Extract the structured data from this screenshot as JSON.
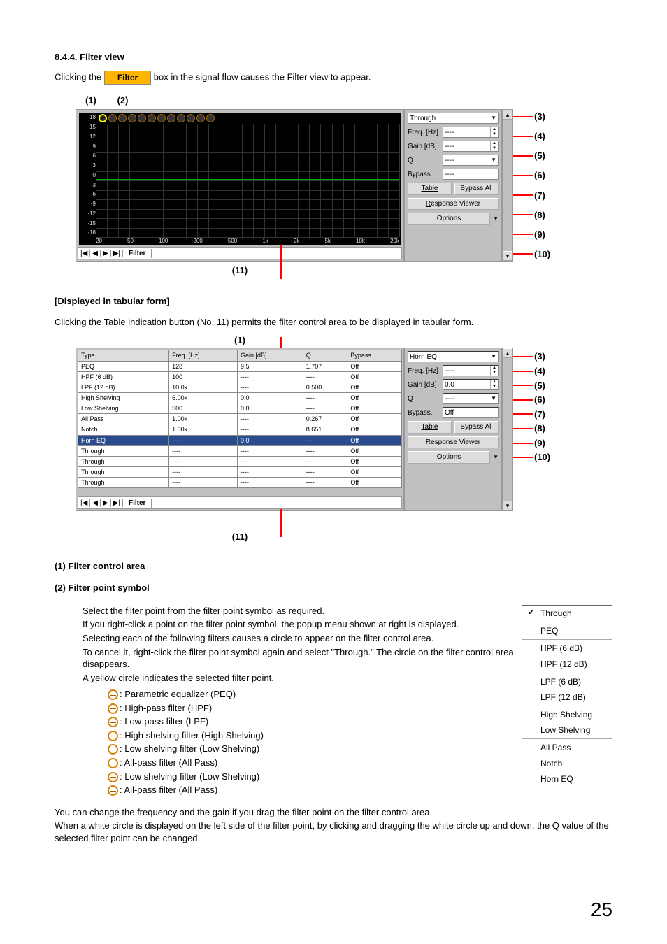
{
  "section": {
    "number": "8.4.4.",
    "title": "Filter view",
    "intro_before": "Clicking the",
    "filter_btn": "Filter",
    "intro_after": "box in the signal flow causes the Filter view to appear."
  },
  "fig1": {
    "labels": {
      "l1": "(1)",
      "l2": "(2)"
    },
    "y_ticks": [
      "18",
      "15",
      "12",
      "9",
      "6",
      "3",
      "0",
      "-3",
      "-6",
      "-9",
      "-12",
      "-15",
      "-18"
    ],
    "x_ticks": [
      "20",
      "50",
      "100",
      "200",
      "500",
      "1k",
      "2k",
      "5k",
      "10k",
      "20k"
    ],
    "panel": {
      "type_label": "",
      "type_value": "Through",
      "freq_label": "Freq. [Hz]",
      "freq_value": "----",
      "gain_label": "Gain [dB]",
      "gain_value": "----",
      "q_label": "Q",
      "q_value": "----",
      "bypass_label": "Bypass.",
      "bypass_value": "----",
      "table_btn": "Table",
      "bypass_all_btn": "Bypass All",
      "response_btn": "Response Viewer",
      "options_btn": "Options"
    },
    "footer": {
      "nav": [
        "|◀",
        "◀",
        "▶",
        "▶|"
      ],
      "tab": "Filter"
    },
    "callouts": [
      "(3)",
      "(4)",
      "(5)",
      "(6)",
      "(7)",
      "(8)",
      "(9)",
      "(10)"
    ],
    "below": "(11)"
  },
  "tabular": {
    "heading": "[Displayed in tabular form]",
    "text": "Clicking the Table indication button (No. 11) permits the filter control area to be displayed in tabular form.",
    "top_label": "(1)",
    "headers": [
      "Type",
      "Freq. [Hz]",
      "Gain [dB]",
      "Q",
      "Bypass"
    ],
    "rows": [
      {
        "type": "PEQ",
        "freq": "128",
        "gain": "9.5",
        "q": "1.707",
        "bypass": "Off"
      },
      {
        "type": "HPF (6 dB)",
        "freq": "100",
        "gain": "----",
        "q": "----",
        "bypass": "Off"
      },
      {
        "type": "LPF (12 dB)",
        "freq": "10.0k",
        "gain": "----",
        "q": "0.500",
        "bypass": "Off"
      },
      {
        "type": "High Shelving",
        "freq": "6.00k",
        "gain": "0.0",
        "q": "----",
        "bypass": "Off"
      },
      {
        "type": "Low Shelving",
        "freq": "500",
        "gain": "0.0",
        "q": "----",
        "bypass": "Off"
      },
      {
        "type": "All Pass",
        "freq": "1.00k",
        "gain": "----",
        "q": "0.267",
        "bypass": "Off"
      },
      {
        "type": "Notch",
        "freq": "1.00k",
        "gain": "----",
        "q": "8.651",
        "bypass": "Off"
      },
      {
        "type": "Horn EQ",
        "freq": "----",
        "gain": "0.0",
        "q": "----",
        "bypass": "Off",
        "selected": true
      },
      {
        "type": "Through",
        "freq": "----",
        "gain": "----",
        "q": "----",
        "bypass": "Off"
      },
      {
        "type": "Through",
        "freq": "----",
        "gain": "----",
        "q": "----",
        "bypass": "Off"
      },
      {
        "type": "Through",
        "freq": "----",
        "gain": "----",
        "q": "----",
        "bypass": "Off"
      },
      {
        "type": "Through",
        "freq": "----",
        "gain": "----",
        "q": "----",
        "bypass": "Off"
      }
    ],
    "panel": {
      "type_value": "Horn EQ",
      "freq_label": "Freq. [Hz]",
      "freq_value": "----",
      "gain_label": "Gain [dB]",
      "gain_value": "0.0",
      "q_label": "Q",
      "q_value": "----",
      "bypass_label": "Bypass.",
      "bypass_value": "Off",
      "table_btn": "Table",
      "bypass_all_btn": "Bypass All",
      "response_btn": "Response Viewer",
      "options_btn": "Options"
    },
    "footer": {
      "nav": [
        "|◀",
        "◀",
        "▶",
        "▶|"
      ],
      "tab": "Filter"
    },
    "callouts": [
      "(3)",
      "(4)",
      "(5)",
      "(6)",
      "(7)",
      "(8)",
      "(9)",
      "(10)"
    ],
    "below": "(11)"
  },
  "desc": {
    "item1_h": "(1) Filter control area",
    "item2_h": "(2) Filter point symbol",
    "item2_p1": "Select the filter point from the filter point symbol as required.",
    "item2_p2": "If you right-click a point on the filter point symbol, the popup menu shown at right is displayed.",
    "item2_p3": "Selecting each of the following filters causes a circle to appear on the filter control area.",
    "item2_p4": "To cancel it, right-click the filter point symbol again and select \"Through.\" The circle on the filter control area disappears.",
    "item2_p5": "A yellow circle indicates the selected filter point.",
    "symbols": [
      {
        "cls": "sym-peq",
        "text": "Parametric equalizer (PEQ)",
        "pfx": ":"
      },
      {
        "cls": "sym-hpf",
        "text": "High-pass filter (HPF)",
        "pfx": ":"
      },
      {
        "cls": "sym-lpf",
        "text": "Low-pass filter (LPF)",
        "pfx": ":"
      },
      {
        "cls": "sym-hs",
        "text": "High shelving filter (High Shelving)",
        "pfx": ":"
      },
      {
        "cls": "sym-ls",
        "text": "Low shelving filter (Low Shelving)",
        "pfx": ":"
      },
      {
        "cls": "sym-ap",
        "text": "All-pass filter (All Pass)",
        "pfx": ":"
      },
      {
        "cls": "sym-ls2",
        "text": "Low shelving filter (Low Shelving)",
        "pfx": ":"
      },
      {
        "cls": "sym-ap2",
        "text": "All-pass filter (All Pass)",
        "pfx": ":"
      }
    ],
    "popup": [
      {
        "label": "Through",
        "checked": true
      },
      {
        "sep": true
      },
      {
        "label": "PEQ"
      },
      {
        "sep": true
      },
      {
        "label": "HPF (6 dB)"
      },
      {
        "label": "HPF (12 dB)"
      },
      {
        "sep": true
      },
      {
        "label": "LPF (6 dB)"
      },
      {
        "label": "LPF (12 dB)"
      },
      {
        "sep": true
      },
      {
        "label": "High Shelving"
      },
      {
        "label": "Low Shelving"
      },
      {
        "sep": true
      },
      {
        "label": "All Pass"
      },
      {
        "label": "Notch"
      },
      {
        "label": "Horn EQ"
      }
    ],
    "tail1": "You can change the frequency and the gain if you drag the filter point on the filter control area.",
    "tail2": "When a white circle is displayed on the left side of the filter point, by clicking and dragging the white circle up and down, the Q value of the selected filter point can be changed."
  },
  "page_number": "25"
}
